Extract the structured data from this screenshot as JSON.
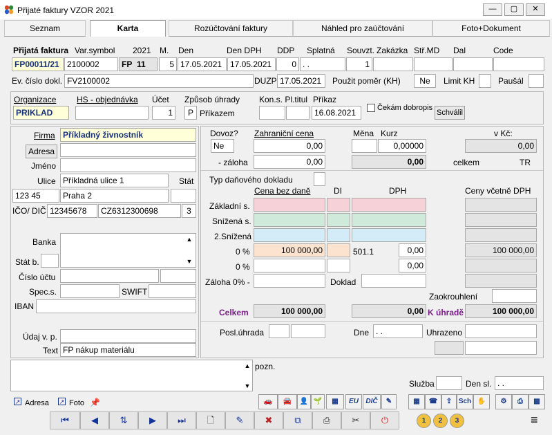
{
  "window": {
    "title": "Přijaté faktury VZOR  2021",
    "min": "—",
    "max": "▢",
    "close": "✕"
  },
  "tabs": [
    "Seznam",
    "Karta",
    "Rozúčtování faktury",
    "Náhled pro zaúčtování",
    "Foto+Dokument"
  ],
  "header": {
    "labels": {
      "prijata": "Přijatá faktura",
      "varsym": "Var.symbol",
      "year": "2021",
      "m": "M.",
      "den": "Den",
      "dendph": "Den DPH",
      "ddp": "DDP",
      "splatna": "Splatná",
      "souvzt": "Souvzt.",
      "zakazka": "Zakázka",
      "strmd": "Stř.MD",
      "dal": "Dal",
      "code": "Code"
    },
    "values": {
      "invoice": "FP00011/21",
      "varsym": "2100002",
      "fp": "FP",
      "fpnum": "11",
      "month": "5",
      "den": "17.05.2021",
      "dendph": "17.05.2021",
      "ddp": "0",
      "splatna": ". .",
      "souvzt": "1"
    },
    "ev_label": "Ev. číslo dokl.",
    "ev_value": "FV2100002",
    "duzp_label": "DUZP",
    "duzp_value": "17.05.2021",
    "pomer_label": "Použit poměr (KH)",
    "pomer_value": "Ne",
    "limit_label": "Limit KH",
    "pausal_label": "Paušál"
  },
  "org": {
    "org_label": "Organizace",
    "org_value": "PRIKLAD",
    "hs_label": "HS - objednávka",
    "ucet_label": "Účet",
    "ucet_value": "1",
    "zpusob_label": "Způsob úhrady",
    "zpusob_code": "P",
    "zpusob_value": "Příkazem",
    "kons_label": "Kon.s. Pl.titul",
    "prikaz_label": "Příkaz",
    "prikaz_value": "16.08.2021",
    "cekam_label": "Čekám dobropis",
    "schvalil": "Schválil"
  },
  "partner": {
    "firma_label": "Firma",
    "firma_value": "Příkladný živnostník",
    "adresa_btn": "Adresa",
    "jmeno_label": "Jméno",
    "ulice_label": "Ulice",
    "ulice_value": "Příkladná ulice 1",
    "stat_label": "Stát",
    "psc": "123 45",
    "mesto": "Praha 2",
    "ico_label": "IČO/ DIČ",
    "ico": "12345678",
    "dic": "CZ6312300698",
    "num": "3",
    "banka_label": "Banka",
    "statb_label": "Stát b.",
    "cislo_label": "Číslo účtu",
    "spec_label": "Spec.s.",
    "swift_label": "SWIFT",
    "iban_label": "IBAN",
    "udaj_label": "Údaj v. p.",
    "text_label": "Text",
    "text_value": "FP nákup materiálu"
  },
  "amounts": {
    "dovoz_label": "Dovoz?",
    "dovoz_value": "Ne",
    "zahr_label": "Zahraniční cena",
    "zahr_value": "0,00",
    "mena_label": "Měna",
    "kurz_label": "Kurz",
    "kurz_value": "0,00000",
    "vkc_label": "v Kč:",
    "vkc_value": "0,00",
    "zaloha_label": "- záloha",
    "zaloha_value": "0,00",
    "zaloha_sum": "0,00",
    "celkem_label": "celkem",
    "celkem_cur": "TR",
    "typ_label": "Typ daňového dokladu",
    "bez_label": "Cena bez daně",
    "di_label": "DI",
    "dph_label": "DPH",
    "vcetne_label": "Ceny včetně DPH",
    "zakladni": "Základní s.",
    "snizena": "Snížená s.",
    "snizena2": "2.Snížená",
    "p0": "0 %",
    "p0_value": "100 000,00",
    "p0_code": "501.1",
    "p0_dph": "0,00",
    "p0_total": "100 000,00",
    "p0b": "0 %",
    "p0b_dph": "0,00",
    "zaloha0": "Záloha 0% -",
    "doklad": "Doklad",
    "zaokr": "Zaokrouhlení",
    "celkem2": "Celkem",
    "celkem_value": "100 000,00",
    "celkem_dph": "0,00",
    "kuhrade": "K úhradě",
    "kuhrade_value": "100 000,00",
    "posl_label": "Posl.úhrada",
    "dne_label": "Dne",
    "dne_value": ". .",
    "uhrazeno_label": "Uhrazeno"
  },
  "bottom": {
    "pozn": "pozn.",
    "sluzba": "Služba",
    "densl": "Den sl.",
    "densl_value": ". .",
    "adresa": "Adresa",
    "foto": "Foto",
    "eu": "EU",
    "dic": "DIČ",
    "sch": "Sch"
  }
}
